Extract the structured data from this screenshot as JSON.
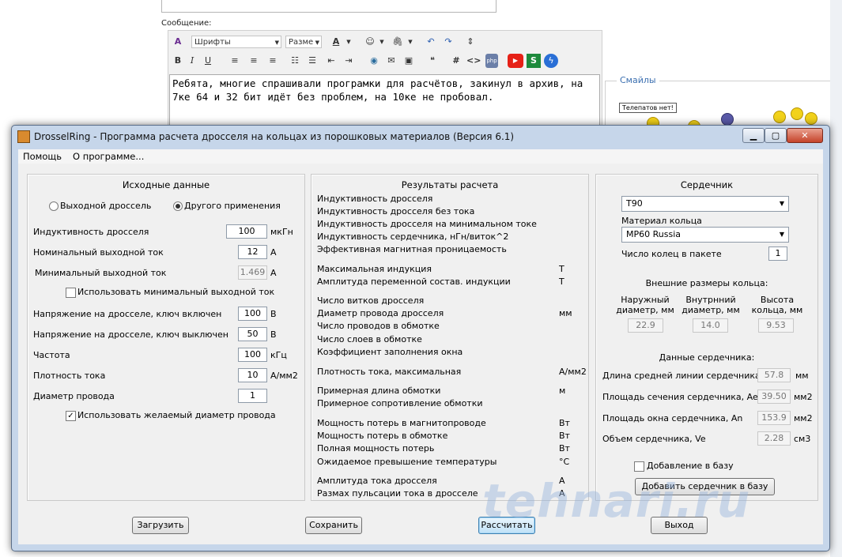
{
  "forum": {
    "message_label": "Сообщение:",
    "toolbar": {
      "font_select": "Шрифты",
      "size_select": "Разме"
    },
    "message_text": "Ребята, многие спрашивали програмки для расчётов, закинул в архив, на 7ке 64 и 32 бит идёт без проблем, на 10ке не пробовал.",
    "smiles_title": "Смайлы",
    "telepat_label": "Телепатов нет!"
  },
  "window": {
    "title": "DrosselRing - Программа расчета дросселя на кольцах из порошковых материалов (Версия 6.1)",
    "menu": [
      "Помощь",
      "О программе..."
    ]
  },
  "input_panel": {
    "title": "Исходные данные",
    "radio_output": "Выходной дроссель",
    "radio_other": "Другого применения",
    "rows": [
      {
        "label": "Индуктивность  дросселя",
        "value": "100",
        "unit": "мкГн"
      },
      {
        "label": "Номинальный выходной ток",
        "value": "12",
        "unit": "A"
      },
      {
        "label": "Минимальный выходной ток",
        "value": "1.469",
        "unit": "A"
      },
      {
        "label": "Напряжение на дросселе, ключ включен",
        "value": "100",
        "unit": "B"
      },
      {
        "label": "Напряжение на дросселе, ключ выключен",
        "value": "50",
        "unit": "B"
      },
      {
        "label": "Частота",
        "value": "100",
        "unit": "кГц"
      },
      {
        "label": "Плотность тока",
        "value": "10",
        "unit": "A/мм2"
      },
      {
        "label": "Диаметр провода",
        "value": "1",
        "unit": ""
      }
    ],
    "use_min_current": "Использовать минимальный выходной ток",
    "use_wire_diameter": "Использовать желаемый диаметр провода"
  },
  "results_panel": {
    "title": "Результаты расчета",
    "rows": [
      {
        "label": "Индуктивность дросселя",
        "unit": ""
      },
      {
        "label": "Индуктивность дросселя без тока",
        "unit": ""
      },
      {
        "label": "Индуктивность дросселя на минимальном токе",
        "unit": ""
      },
      {
        "label": "Индуктивность сердечника, нГн/виток^2",
        "unit": ""
      },
      {
        "label": "Эффективная магнитная проницаемость",
        "unit": ""
      },
      {
        "label": "Максимальная индукция",
        "unit": "T"
      },
      {
        "label": "Амплитуда переменной состав. индукции",
        "unit": "T"
      },
      {
        "label": "Число витков дросселя",
        "unit": ""
      },
      {
        "label": "Диаметр провода дросселя",
        "unit": "мм"
      },
      {
        "label": "Число проводов в обмотке",
        "unit": ""
      },
      {
        "label": "Число слоев в обмотке",
        "unit": ""
      },
      {
        "label": "Коэффициент заполнения окна",
        "unit": ""
      },
      {
        "label": "Плотность тока, максимальная",
        "unit": "A/мм2"
      },
      {
        "label": "Примерная длина обмотки",
        "unit": "м"
      },
      {
        "label": "Примерное сопротивление обмотки",
        "unit": ""
      },
      {
        "label": "Мощность потерь в магнитопроводе",
        "unit": "Вт"
      },
      {
        "label": "Мощность потерь в обмотке",
        "unit": "Вт"
      },
      {
        "label": "Полная мощность потерь",
        "unit": "Вт"
      },
      {
        "label": "Ожидаемое превышение температуры",
        "unit": "°C"
      },
      {
        "label": "Амплитуда тока дросселя",
        "unit": "A"
      },
      {
        "label": "Размах пульсации тока в дросселе",
        "unit": "A"
      }
    ]
  },
  "core_panel": {
    "title": "Сердечник",
    "core_select": "T90",
    "material_label": "Материал кольца",
    "material_select": "MP60 Russia",
    "rings_label": "Число колец в пакете",
    "rings_value": "1",
    "sizes_title": "Внешние размеры кольца:",
    "sizes": [
      {
        "label_1": "Наружный",
        "label_2": "диаметр, мм",
        "value": "22.9"
      },
      {
        "label_1": "Внутрнний",
        "label_2": "диаметр, мм",
        "value": "14.0"
      },
      {
        "label_1": "Высота",
        "label_2": "кольца, мм",
        "value": "9.53"
      }
    ],
    "data_title": "Данные сердечника:",
    "data": [
      {
        "label": "Длина средней линии сердечника, le",
        "value": "57.8",
        "unit": "мм"
      },
      {
        "label": "Площадь сечения сердечника, Ae",
        "value": "39.50",
        "unit": "мм2"
      },
      {
        "label": "Площадь окна сердечника, An",
        "value": "153.9",
        "unit": "мм2"
      },
      {
        "label": "Объем сердечника, Ve",
        "value": "2.28",
        "unit": "см3"
      }
    ],
    "add_to_db_check": "Добавление в базу",
    "add_core_button": "Добавить сердечник в базу"
  },
  "buttons": {
    "load": "Загрузить",
    "save": "Сохранить",
    "calculate": "Рассчитать",
    "exit": "Выход"
  },
  "watermark": "tehnari.ru"
}
